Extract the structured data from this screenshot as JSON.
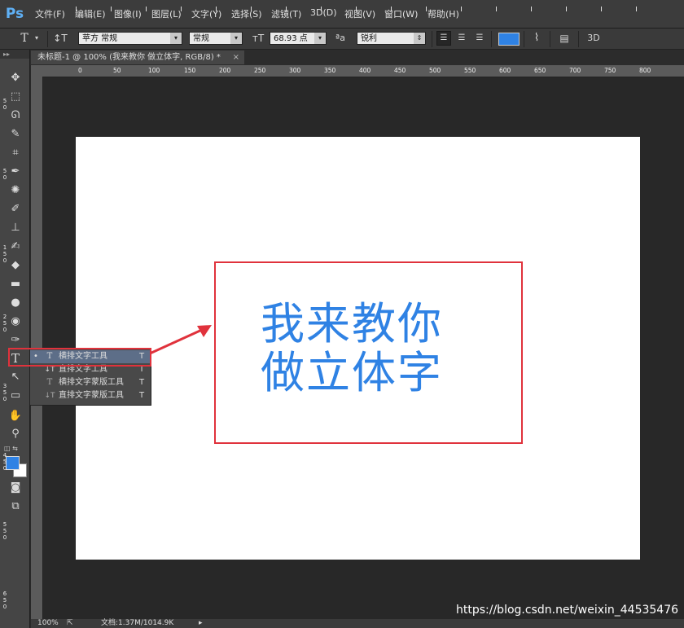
{
  "app": {
    "logo": "Ps",
    "accent": "#2f82e4",
    "frame_color": "#e0323c"
  },
  "menu": [
    "文件(F)",
    "编辑(E)",
    "图像(I)",
    "图层(L)",
    "文字(Y)",
    "选择(S)",
    "滤镜(T)",
    "3D(D)",
    "视图(V)",
    "窗口(W)",
    "帮助(H)"
  ],
  "options": {
    "tool_icon": "T",
    "font_family": "苹方 常规",
    "font_style": "常规",
    "font_size": "68.93 点",
    "aa_icon": "ªa",
    "antialias": "锐利",
    "three_d": "3D"
  },
  "document": {
    "tab_title": "未标题-1 @ 100% (我来教你 做立体字, RGB/8) *",
    "close": "×"
  },
  "ruler": {
    "h_ticks": [
      "0",
      "50",
      "100",
      "150",
      "200",
      "250",
      "300",
      "350",
      "400",
      "450",
      "500",
      "550",
      "600",
      "650",
      "700",
      "750",
      "800"
    ]
  },
  "canvas": {
    "line1": "我来教你",
    "line2": "做立体字"
  },
  "flyout": [
    {
      "bullet": "•",
      "icon": "T",
      "label": "横排文字工具",
      "key": "T"
    },
    {
      "bullet": "",
      "icon": "↓T",
      "label": "直排文字工具",
      "key": "T"
    },
    {
      "bullet": "",
      "icon": "T",
      "label": "横排文字蒙版工具",
      "key": "T"
    },
    {
      "bullet": "",
      "icon": "↓T",
      "label": "直排文字蒙版工具",
      "key": "T"
    }
  ],
  "status": {
    "zoom": "100%",
    "doc": "文档:1.37M/1014.9K"
  },
  "watermark": "https://blog.csdn.net/weixin_44535476"
}
